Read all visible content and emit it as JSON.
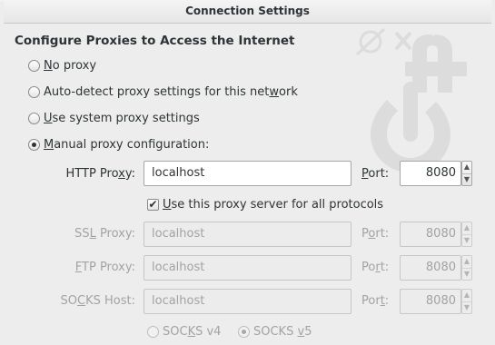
{
  "window": {
    "title": "Connection Settings"
  },
  "section_title": "Configure Proxies to Access the Internet",
  "proxy_modes": [
    {
      "pre": "",
      "mn": "N",
      "post": "o proxy",
      "selected": false
    },
    {
      "pre": "Auto-detect proxy settings for this net",
      "mn": "w",
      "post": "ork",
      "selected": false
    },
    {
      "pre": "",
      "mn": "U",
      "post": "se system proxy settings",
      "selected": false
    },
    {
      "pre": "",
      "mn": "M",
      "post": "anual proxy configuration:",
      "selected": true
    }
  ],
  "http": {
    "label_pre": "HTTP Pro",
    "label_mn": "x",
    "label_post": "y:",
    "value": "localhost",
    "port_label_mn": "P",
    "port_label_post": "ort:",
    "port": "8080"
  },
  "share_all": {
    "checked": true,
    "mark": "✔",
    "label_mn": "U",
    "label_post": "se this proxy server for all protocols"
  },
  "ssl": {
    "label_pre": "SS",
    "label_mn": "L",
    "label_post": " Proxy:",
    "value": "localhost",
    "port_label_pre": "P",
    "port_label_mn": "o",
    "port_label_post": "rt:",
    "port": "8080"
  },
  "ftp": {
    "label_mn": "F",
    "label_post": "TP Proxy:",
    "value": "localhost",
    "port_label_pre": "Po",
    "port_label_mn": "r",
    "port_label_post": "t:",
    "port": "8080"
  },
  "socks": {
    "label_pre": "SO",
    "label_mn": "C",
    "label_post": "KS Host:",
    "value": "localhost",
    "port_label_pre": "Por",
    "port_label_mn": "t",
    "port_label_post": ":",
    "port": "8080"
  },
  "socks_versions": [
    {
      "pre": "SOC",
      "mn": "K",
      "post": "S v4",
      "selected": false
    },
    {
      "pre": "SOCKS ",
      "mn": "v",
      "post": "5",
      "selected": true
    }
  ],
  "spin": {
    "up": "▲",
    "down": "▼"
  }
}
